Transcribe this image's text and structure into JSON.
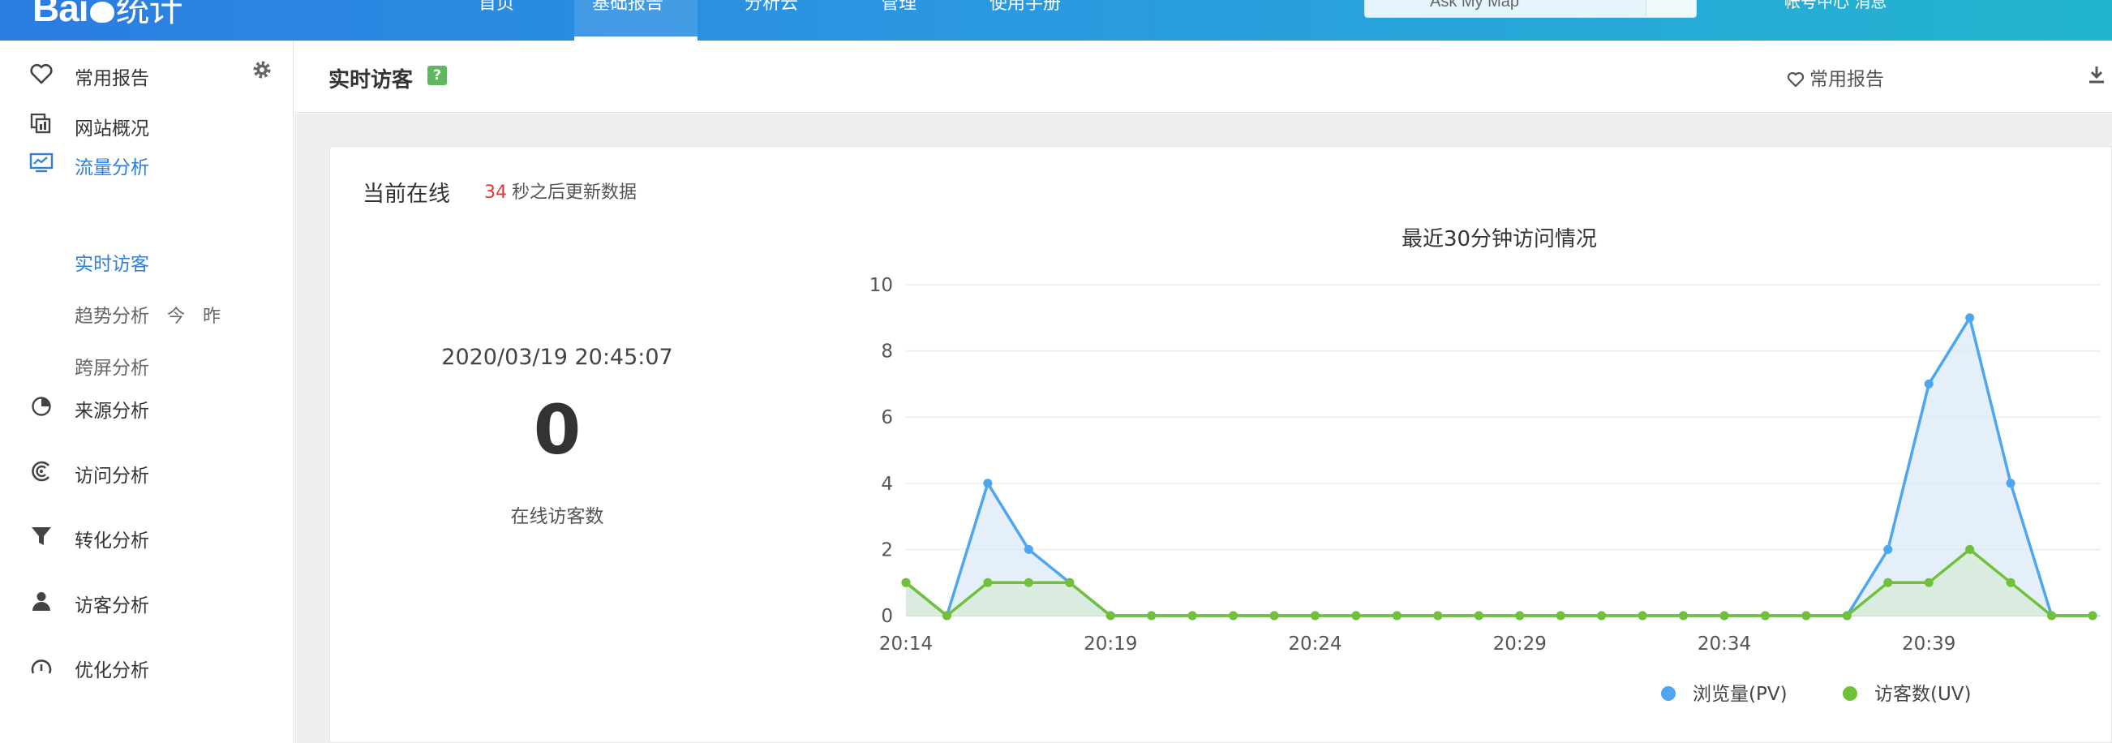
{
  "brand": {
    "logo_text": "Bai",
    "logo_cn": "统计"
  },
  "topnav": {
    "items": [
      {
        "label": "首页",
        "active": false
      },
      {
        "label": "基础报告",
        "active": true
      },
      {
        "label": "分析云",
        "active": false
      },
      {
        "label": "管理",
        "active": false
      },
      {
        "label": "使用手册",
        "active": false
      }
    ]
  },
  "search": {
    "value": "Ask My Map"
  },
  "top_right": {
    "text": "帐号中心   消息"
  },
  "sidebar": {
    "favorites": {
      "label": "常用报告"
    },
    "overview": {
      "label": "网站概况"
    },
    "traffic": {
      "label": "流量分析",
      "sub": {
        "realtime": "实时访客",
        "trend": "趋势分析",
        "trend_today": "今",
        "trend_yesterday": "昨",
        "cross_screen": "跨屏分析"
      }
    },
    "source": {
      "label": "来源分析"
    },
    "visit": {
      "label": "访问分析"
    },
    "conversion": {
      "label": "转化分析"
    },
    "visitor": {
      "label": "访客分析"
    },
    "optimization": {
      "label": "优化分析"
    }
  },
  "header": {
    "title": "实时访客",
    "help": "?",
    "fav_report": "常用报告"
  },
  "online": {
    "title": "当前在线",
    "countdown_seconds": "34",
    "countdown_suffix": "秒之后更新数据",
    "datetime": "2020/03/19 20:45:07",
    "count": "0",
    "count_label": "在线访客数"
  },
  "chart_data": {
    "type": "area",
    "title": "最近30分钟访问情况",
    "x": [
      "20:14",
      "20:15",
      "20:16",
      "20:17",
      "20:18",
      "20:19",
      "20:20",
      "20:21",
      "20:22",
      "20:23",
      "20:24",
      "20:25",
      "20:26",
      "20:27",
      "20:28",
      "20:29",
      "20:30",
      "20:31",
      "20:32",
      "20:33",
      "20:34",
      "20:35",
      "20:36",
      "20:37",
      "20:38",
      "20:39",
      "20:40",
      "20:41",
      "20:42",
      "20:43"
    ],
    "x_tick_labels": [
      "20:14",
      "20:19",
      "20:24",
      "20:29",
      "20:34",
      "20:39"
    ],
    "ylim": [
      0,
      10
    ],
    "y_ticks": [
      0,
      2,
      4,
      6,
      8,
      10
    ],
    "grid": true,
    "legend_position": "bottom",
    "series": [
      {
        "name": "浏览量(PV)",
        "color": "#4da6ee",
        "fill": "#dbeaf8",
        "values": [
          1,
          0,
          4,
          2,
          1,
          0,
          0,
          0,
          0,
          0,
          0,
          0,
          0,
          0,
          0,
          0,
          0,
          0,
          0,
          0,
          0,
          0,
          0,
          0,
          2,
          7,
          9,
          4,
          0,
          0
        ]
      },
      {
        "name": "访客数(UV)",
        "color": "#71c03a",
        "fill": "#d5ebd6",
        "values": [
          1,
          0,
          1,
          1,
          1,
          0,
          0,
          0,
          0,
          0,
          0,
          0,
          0,
          0,
          0,
          0,
          0,
          0,
          0,
          0,
          0,
          0,
          0,
          0,
          1,
          1,
          2,
          1,
          0,
          0
        ]
      }
    ]
  }
}
